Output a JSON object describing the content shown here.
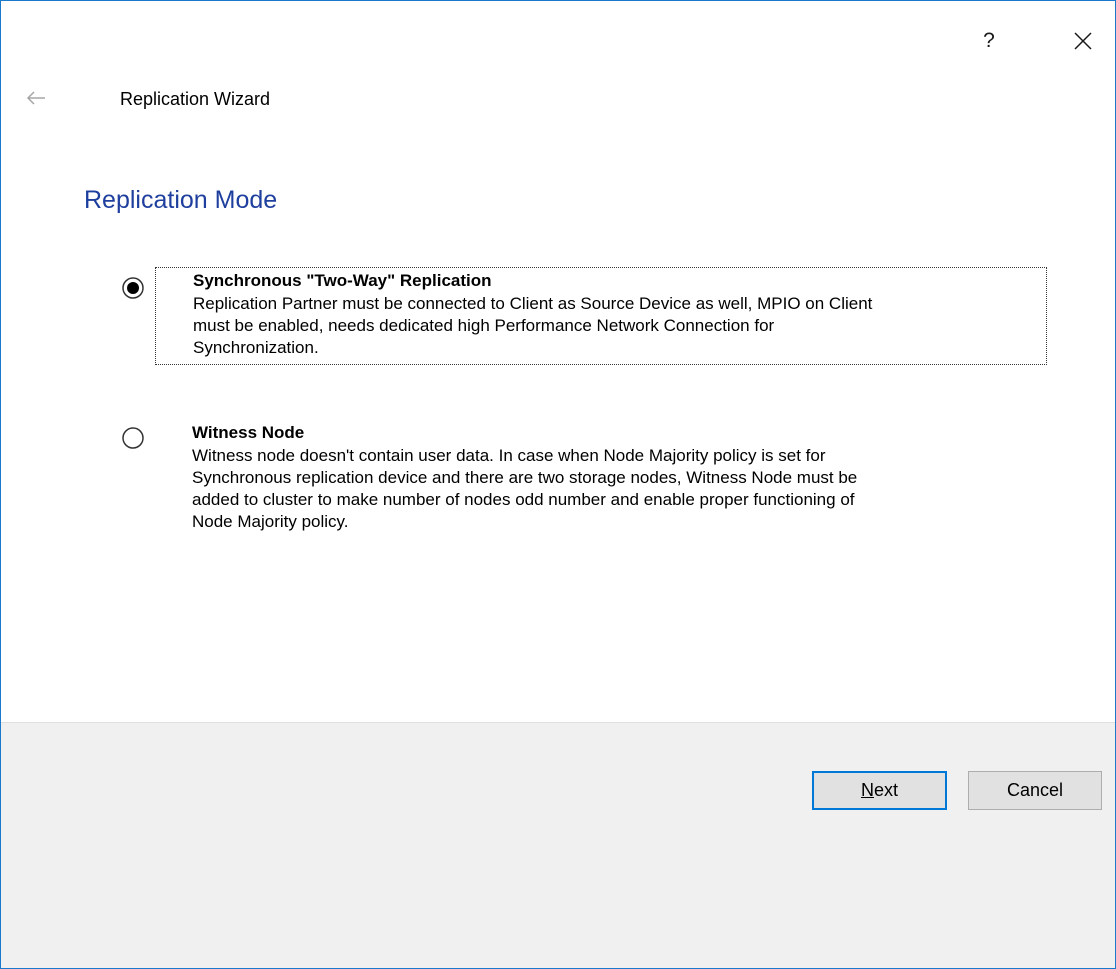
{
  "title_bar": {
    "help_label": "?",
    "close_icon": "close-icon"
  },
  "header": {
    "back_icon": "back-arrow-icon",
    "wizard_title": "Replication Wizard"
  },
  "page": {
    "heading": "Replication Mode"
  },
  "options": [
    {
      "title": "Synchronous \"Two-Way\" Replication",
      "description": "Replication Partner must be connected to Client as Source Device as well, MPIO on Client\nmust be enabled, needs dedicated high Performance Network Connection for\nSynchronization.",
      "selected": true
    },
    {
      "title": "Witness Node",
      "description": "Witness node doesn't contain user data. In case when Node Majority policy is set for\nSynchronous replication device and there are two storage nodes, Witness Node must be\nadded to cluster to make number of nodes odd number and enable proper functioning of\nNode Majority policy.",
      "selected": false
    }
  ],
  "footer": {
    "next_label": "Next",
    "next_mnemonic": "N",
    "next_rest": "ext",
    "cancel_label": "Cancel"
  },
  "colors": {
    "heading": "#1f3f9e",
    "window_border": "#1979ca",
    "default_button_border": "#0078d7",
    "footer_bg": "#f0f0f0"
  }
}
